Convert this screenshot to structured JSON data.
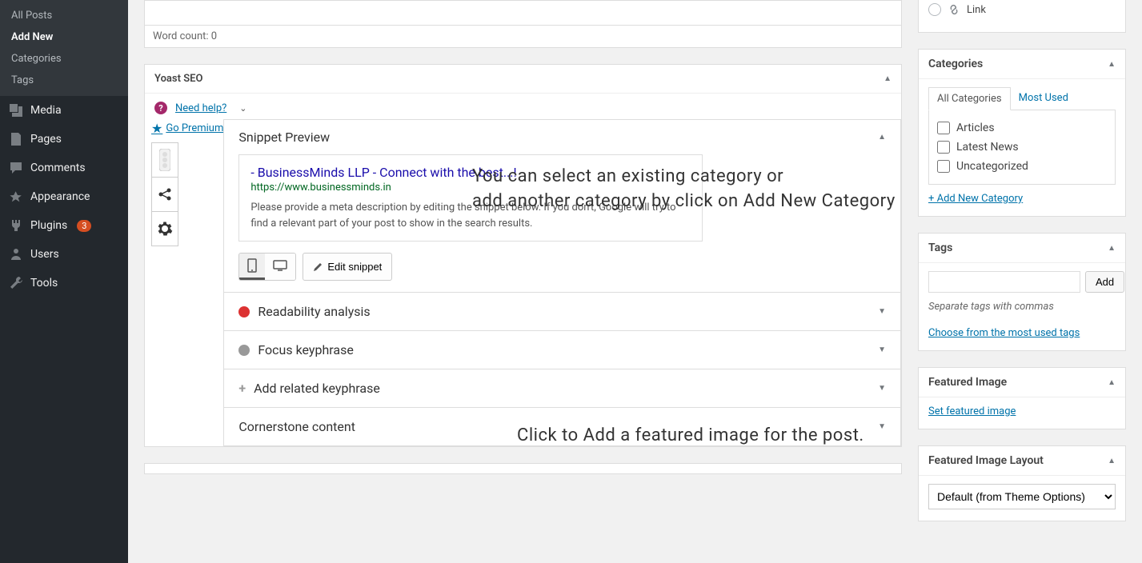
{
  "sidebar": {
    "sub": [
      "All Posts",
      "Add New",
      "Categories",
      "Tags"
    ],
    "active_sub": "Add New",
    "menu": [
      {
        "label": "Media",
        "icon": "media"
      },
      {
        "label": "Pages",
        "icon": "pages"
      },
      {
        "label": "Comments",
        "icon": "comments"
      },
      {
        "label": "Appearance",
        "icon": "appearance"
      },
      {
        "label": "Plugins",
        "icon": "plugins",
        "badge": "3"
      },
      {
        "label": "Users",
        "icon": "users"
      },
      {
        "label": "Tools",
        "icon": "tools"
      }
    ]
  },
  "editor": {
    "word_count": "Word count: 0"
  },
  "yoast": {
    "title": "Yoast SEO",
    "need_help": "Need help?",
    "go_premium": "Go Premium",
    "snippet_preview_label": "Snippet Preview",
    "snippet_title": "- BusinessMinds LLP - Connect with the best...!",
    "snippet_url": "https://www.businessminds.in",
    "snippet_desc": "Please provide a meta description by editing the snippet below. If you don't, Google will try to find a relevant part of your post to show in the search results.",
    "edit_snippet": "Edit snippet",
    "readability": "Readability analysis",
    "focus_keyphrase": "Focus keyphrase",
    "add_related": "Add related keyphrase",
    "cornerstone": "Cornerstone content"
  },
  "format": {
    "link": "Link"
  },
  "categories": {
    "title": "Categories",
    "tab_all": "All Categories",
    "tab_most": "Most Used",
    "items": [
      "Articles",
      "Latest News",
      "Uncategorized"
    ],
    "add_new": "+ Add New Category"
  },
  "tags": {
    "title": "Tags",
    "add_btn": "Add",
    "hint": "Separate tags with commas",
    "choose": "Choose from the most used tags"
  },
  "featured": {
    "title": "Featured Image",
    "set": "Set featured image"
  },
  "layout": {
    "title": "Featured Image Layout",
    "default": "Default (from Theme Options)"
  },
  "overlays": {
    "cat_hint": "You can select an existing category or\nadd another category by click on Add New Category",
    "feat_hint": "Click to Add a featured image for the post."
  }
}
